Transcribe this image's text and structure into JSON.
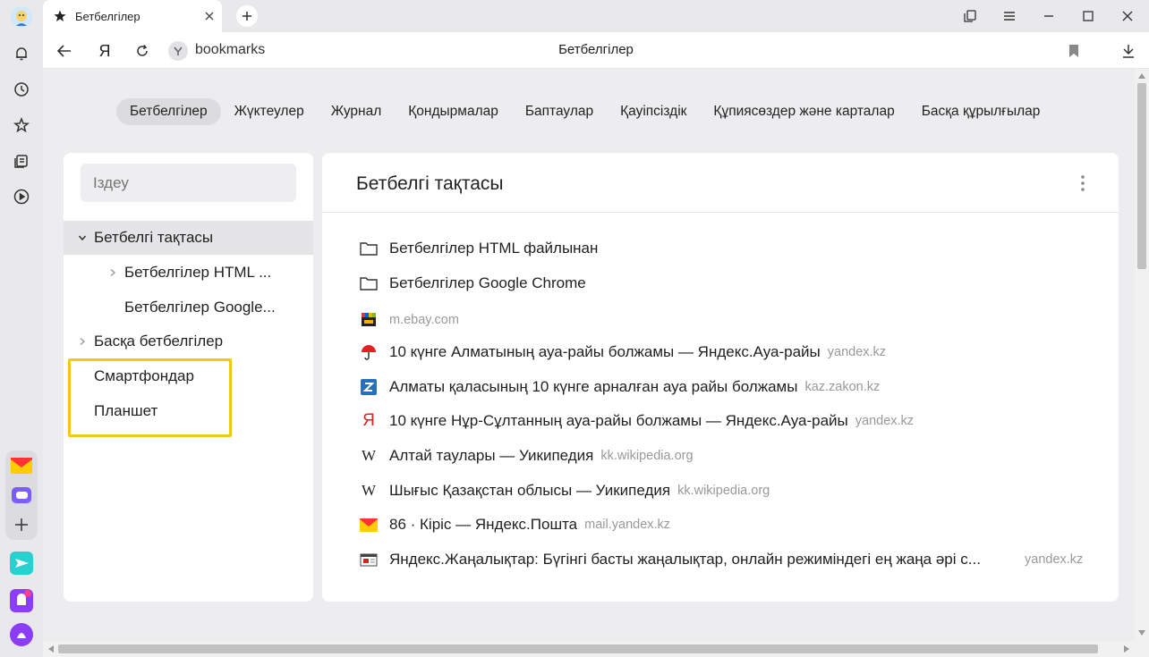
{
  "browser": {
    "tab": {
      "title": "Бетбелгілер",
      "icon": "star-icon"
    },
    "window_controls": [
      "collections-icon",
      "menu-icon",
      "minimize-icon",
      "maximize-icon",
      "close-icon"
    ]
  },
  "addressbar": {
    "back_icon": "back-arrow-icon",
    "yandex_logo": "Я",
    "reload_icon": "reload-icon",
    "url": "bookmarks",
    "page_title": "Бетбелгілер"
  },
  "sidebar_icons": [
    "avatar",
    "bell-icon",
    "history-icon",
    "star-icon",
    "collections-icon",
    "play-icon",
    "mail-icon",
    "messenger-icon",
    "plus-icon",
    "telemost-icon",
    "disk-icon",
    "alice-icon"
  ],
  "top_nav": {
    "items": [
      {
        "label": "Бетбелгілер",
        "active": true
      },
      {
        "label": "Жүктеулер",
        "active": false
      },
      {
        "label": "Журнал",
        "active": false
      },
      {
        "label": "Қондырмалар",
        "active": false
      },
      {
        "label": "Баптаулар",
        "active": false
      },
      {
        "label": "Қауіпсіздік",
        "active": false
      },
      {
        "label": "Құпиясөздер және карталар",
        "active": false
      },
      {
        "label": "Басқа құрылғылар",
        "active": false
      }
    ]
  },
  "left_panel": {
    "search_placeholder": "Іздеу",
    "tree": [
      {
        "label": "Бетбелгі тақтасы",
        "expanded": true,
        "level": 0,
        "selected": true
      },
      {
        "label": "Бетбелгілер HTML ...",
        "expanded": false,
        "level": 1
      },
      {
        "label": "Бетбелгілер Google...",
        "level": 1
      },
      {
        "label": "Басқа бетбелгілер",
        "expanded": false,
        "level": 0
      },
      {
        "label": "Смартфондар",
        "level": 0
      },
      {
        "label": "Планшет",
        "level": 0
      }
    ]
  },
  "right_panel": {
    "title": "Бетбелгі тақтасы",
    "bookmarks": [
      {
        "title": "Бетбелгілер HTML файлынан",
        "domain": "",
        "icon": "folder-icon"
      },
      {
        "title": "Бетбелгілер Google Chrome",
        "domain": "",
        "icon": "folder-icon"
      },
      {
        "title": "m.ebay.com",
        "domain": "",
        "icon": "ebay-favicon"
      },
      {
        "title": "10 күнге Алматының ауа-райы болжамы — Яндекс.Ауа-райы",
        "domain": "yandex.kz",
        "icon": "umbrella-favicon"
      },
      {
        "title": "Алматы қаласының 10 күнге арналған ауа райы болжамы",
        "domain": "kaz.zakon.kz",
        "icon": "zakon-favicon"
      },
      {
        "title": "10 күнге Нұр-Сұлтанның ауа-райы болжамы — Яндекс.Ауа-райы",
        "domain": "yandex.kz",
        "icon": "yandex-favicon"
      },
      {
        "title": "Алтай таулары — Уикипедия",
        "domain": "kk.wikipedia.org",
        "icon": "wikipedia-favicon"
      },
      {
        "title": "Шығыс Қазақстан облысы — Уикипедия",
        "domain": "kk.wikipedia.org",
        "icon": "wikipedia-favicon"
      },
      {
        "title": "86 · Кіріс — Яндекс.Пошта",
        "domain": "mail.yandex.kz",
        "icon": "mail-favicon"
      },
      {
        "title": "Яндекс.Жаңалықтар: Бүгінгі басты жаңалықтар, онлайн режиміндегі ең жаңа әрі с...",
        "domain": "yandex.kz",
        "icon": "news-favicon"
      }
    ]
  },
  "colors": {
    "highlight_box": "#f5c518",
    "accent_red": "#e31e24",
    "page_bg": "#ededef"
  }
}
